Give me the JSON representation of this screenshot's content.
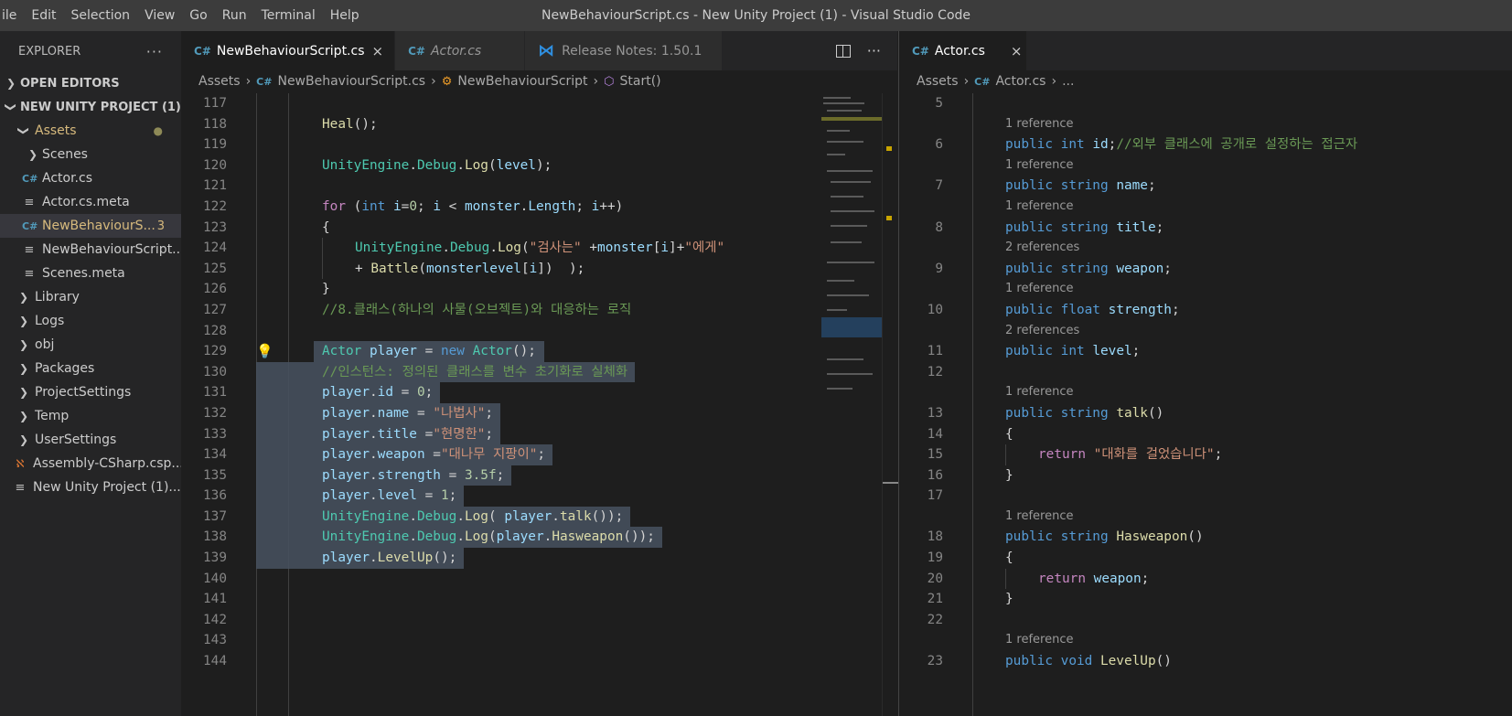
{
  "window": {
    "title": "NewBehaviourScript.cs - New Unity Project (1) - Visual Studio Code",
    "menu": [
      "ile",
      "Edit",
      "Selection",
      "View",
      "Go",
      "Run",
      "Terminal",
      "Help"
    ]
  },
  "sidebar": {
    "title": "EXPLORER",
    "more": "···",
    "open_editors": "OPEN EDITORS",
    "project": "NEW UNITY PROJECT (1)",
    "assets_label": "Assets",
    "items": [
      {
        "label": "Scenes",
        "icon": "chevron-right-icon"
      },
      {
        "label": "Actor.cs",
        "icon": "csharp-icon"
      },
      {
        "label": "Actor.cs.meta",
        "icon": "meta-file-icon"
      },
      {
        "label": "NewBehaviourS...",
        "icon": "csharp-icon",
        "badge": "3"
      },
      {
        "label": "NewBehaviourScript....",
        "icon": "meta-file-icon"
      },
      {
        "label": "Scenes.meta",
        "icon": "meta-file-icon"
      }
    ],
    "root_items": [
      {
        "label": "Library"
      },
      {
        "label": "Logs"
      },
      {
        "label": "obj"
      },
      {
        "label": "Packages"
      },
      {
        "label": "ProjectSettings"
      },
      {
        "label": "Temp"
      },
      {
        "label": "UserSettings"
      }
    ],
    "root_files": [
      {
        "label": "Assembly-CSharp.csp...",
        "icon": "rss-icon"
      },
      {
        "label": "New Unity Project (1)....",
        "icon": "meta-file-icon"
      }
    ]
  },
  "editor1": {
    "tabs": [
      {
        "label": "NewBehaviourScript.cs",
        "close": "×"
      },
      {
        "label": "Actor.cs"
      },
      {
        "label": "Release Notes: 1.50.1"
      }
    ],
    "more": "···",
    "breadcrumb": [
      "Assets",
      "NewBehaviourScript.cs",
      "NewBehaviourScript",
      "Start()"
    ],
    "line_numbers": [
      "117",
      "118",
      "119",
      "120",
      "121",
      "122",
      "123",
      "124",
      "125",
      "126",
      "127",
      "128",
      "129",
      "130",
      "131",
      "132",
      "133",
      "134",
      "135",
      "136",
      "137",
      "138",
      "139",
      "140",
      "141",
      "142",
      "143",
      "144"
    ],
    "code": {
      "l118_a": "Heal",
      "l118_b": "();",
      "l120_a": "UnityEngine",
      "l120_b": ".",
      "l120_c": "Debug",
      "l120_d": ".",
      "l120_e": "Log",
      "l120_f": "(",
      "l120_g": "level",
      "l120_h": ");",
      "l122_for": "for",
      "l122_a": " (",
      "l122_int": "int",
      "l122_i": " i",
      "l122_eq": "=",
      "l122_0": "0",
      "l122_b": "; ",
      "l122_i2": "i",
      "l122_lt": " < ",
      "l122_m": "monster",
      "l122_d": ".",
      "l122_len": "Length",
      "l122_c": "; ",
      "l122_i3": "i",
      "l122_pp": "++)",
      "l123": "{",
      "l124_a": "UnityEngine",
      "l124_b": ".",
      "l124_c": "Debug",
      "l124_d": ".",
      "l124_e": "Log",
      "l124_f": "(",
      "l124_s1": "\"검사는\"",
      "l124_g": " +",
      "l124_m": "monster",
      "l124_h": "[",
      "l124_i": "i",
      "l124_j": "]+",
      "l124_s2": "\"에게\"",
      "l125_a": "+ ",
      "l125_b": "Battle",
      "l125_c": "(",
      "l125_d": "monsterlevel",
      "l125_e": "[",
      "l125_f": "i",
      "l125_g": "])  );",
      "l126": "}",
      "l127": "//8.클래스(하나의 사물(오브젝트)와 대응하는 로직",
      "l129_a": "Actor",
      "l129_b": " player",
      "l129_c": " = ",
      "l129_d": "new",
      "l129_e": " Actor",
      "l129_f": "();",
      "l130": "//인스턴스: 정의된 클래스를 변수 초기화로 실체화",
      "l131_a": "player",
      "l131_b": ".",
      "l131_c": "id",
      "l131_d": " = ",
      "l131_e": "0",
      "l131_f": ";",
      "l132_a": "player",
      "l132_b": ".",
      "l132_c": "name",
      "l132_d": " = ",
      "l132_e": "\"나법사\"",
      "l132_f": ";",
      "l133_a": "player",
      "l133_b": ".",
      "l133_c": "title",
      "l133_d": " =",
      "l133_e": "\"현명한\"",
      "l133_f": ";",
      "l134_a": "player",
      "l134_b": ".",
      "l134_c": "weapon",
      "l134_d": " =",
      "l134_e": "\"대나무 지팡이\"",
      "l134_f": ";",
      "l135_a": "player",
      "l135_b": ".",
      "l135_c": "strength",
      "l135_d": " = ",
      "l135_e": "3.5f",
      "l135_f": ";",
      "l136_a": "player",
      "l136_b": ".",
      "l136_c": "level",
      "l136_d": " = ",
      "l136_e": "1",
      "l136_f": ";",
      "l137_a": "UnityEngine",
      "l137_b": ".",
      "l137_c": "Debug",
      "l137_d": ".",
      "l137_e": "Log",
      "l137_f": "( ",
      "l137_g": "player",
      "l137_h": ".",
      "l137_i": "talk",
      "l137_j": "());",
      "l138_a": "UnityEngine",
      "l138_b": ".",
      "l138_c": "Debug",
      "l138_d": ".",
      "l138_e": "Log",
      "l138_f": "(",
      "l138_g": "player",
      "l138_h": ".",
      "l138_i": "Hasweapon",
      "l138_j": "());",
      "l139_a": "player",
      "l139_b": ".",
      "l139_c": "LevelUp",
      "l139_d": "();"
    }
  },
  "editor2": {
    "tab": {
      "label": "Actor.cs",
      "close": "×"
    },
    "breadcrumb": [
      "Assets",
      "Actor.cs",
      "..."
    ],
    "refs": {
      "r1": "1 reference",
      "r2": "2 references"
    },
    "code": {
      "l6_a": "public",
      "l6_b": "int",
      "l6_c": "id",
      "l6_d": ";",
      "l6_e": "//외부 클래스에 공개로 설정하는 접근자",
      "l7_a": "public",
      "l7_b": "string",
      "l7_c": "name",
      "l7_d": ";",
      "l8_c": "title",
      "l9_c": "weapon",
      "l10_b": "float",
      "l10_c": "strength",
      "l11_c": "level",
      "l13_c": "talk",
      "l13_d": "()",
      "l14": "{",
      "l15_a": "return",
      "l15_b": "\"대화를 걸었습니다\"",
      "l15_c": ";",
      "l16": "}",
      "l18_c": "Hasweapon",
      "l20_b": "weapon",
      "l23_b": "void",
      "l23_c": "LevelUp"
    },
    "line_numbers": [
      "5",
      "6",
      "7",
      "8",
      "9",
      "10",
      "11",
      "12",
      "13",
      "14",
      "15",
      "16",
      "17",
      "18",
      "19",
      "20",
      "21",
      "22",
      "23"
    ]
  }
}
